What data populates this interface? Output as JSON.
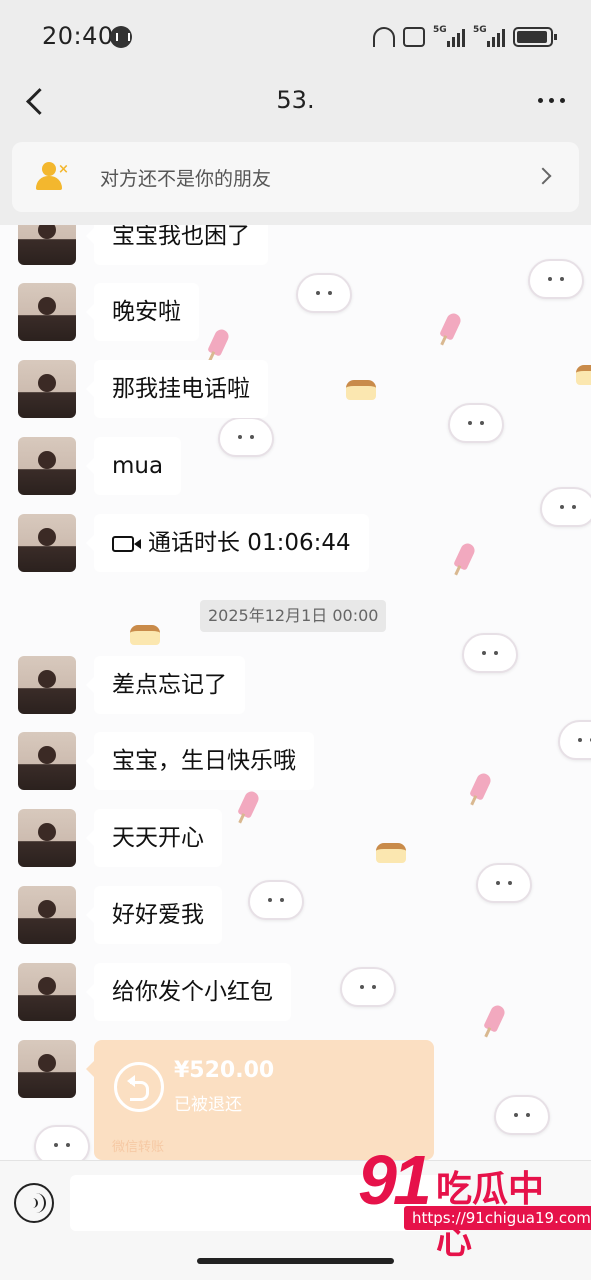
{
  "status_bar": {
    "time": "20:40",
    "network_1": "5G",
    "network_2": "5G"
  },
  "nav": {
    "title": "53."
  },
  "banner": {
    "text": "对方还不是你的朋友"
  },
  "messages": [
    {
      "text": "宝宝我也困了"
    },
    {
      "text": "晚安啦"
    },
    {
      "text": "那我挂电话啦"
    },
    {
      "text": "mua"
    },
    {
      "text": "通话时长 01:06:44",
      "icon": "video-call-icon"
    },
    {
      "text": "差点忘记了"
    },
    {
      "text": "宝宝，生日快乐哦"
    },
    {
      "text": "天天开心"
    },
    {
      "text": "好好爱我"
    },
    {
      "text": "给你发个小红包"
    }
  ],
  "timestamp": "2025年12月1日 00:00",
  "transfer": {
    "amount": "¥520.00",
    "status": "已被退还",
    "source": "微信转账",
    "icon": "return-arrow-icon",
    "color": "#fbdfc2"
  },
  "watermark": {
    "number": "91",
    "title": "吃瓜中心",
    "url": "https://91chigua19.com",
    "color": "#e6124a"
  },
  "colors": {
    "banner_icon": "#f3b72e",
    "background": "#ededed",
    "bubble": "#ffffff"
  }
}
